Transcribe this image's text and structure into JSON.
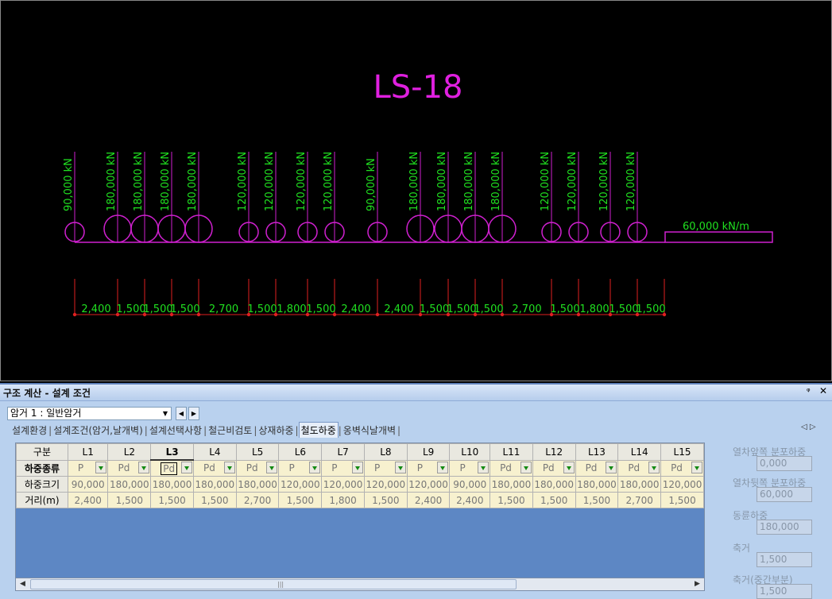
{
  "drawing": {
    "title": "LS-18",
    "loads": [
      {
        "label": "90,000 kN",
        "size": "small"
      },
      {
        "label": "180,000 kN",
        "size": "large"
      },
      {
        "label": "180,000 kN",
        "size": "large"
      },
      {
        "label": "180,000 kN",
        "size": "large"
      },
      {
        "label": "180,000 kN",
        "size": "large"
      },
      {
        "label": "120,000 kN",
        "size": "small"
      },
      {
        "label": "120,000 kN",
        "size": "small"
      },
      {
        "label": "120,000 kN",
        "size": "small"
      },
      {
        "label": "120,000 kN",
        "size": "small"
      },
      {
        "label": "90,000 kN",
        "size": "small"
      },
      {
        "label": "180,000 kN",
        "size": "large"
      },
      {
        "label": "180,000 kN",
        "size": "large"
      },
      {
        "label": "180,000 kN",
        "size": "large"
      },
      {
        "label": "180,000 kN",
        "size": "large"
      },
      {
        "label": "120,000 kN",
        "size": "small"
      },
      {
        "label": "120,000 kN",
        "size": "small"
      },
      {
        "label": "120,000 kN",
        "size": "small"
      },
      {
        "label": "120,000 kN",
        "size": "small"
      }
    ],
    "distributed_load": "60,000 kN/m",
    "spacings": [
      "2,400",
      "1,500",
      "1,500",
      "1,500",
      "2,700",
      "1,500",
      "1,800",
      "1,500",
      "2,400",
      "2,400",
      "1,500",
      "1,500",
      "1,500",
      "2,700",
      "1,500",
      "1,800",
      "1,500",
      "1,500"
    ],
    "colors": {
      "title": "#e020e0",
      "load_text": "#20e020",
      "shape": "#d020d0",
      "dim_line": "#e02020",
      "background": "#000000"
    }
  },
  "panel": {
    "title": "구조 계산 - 설계 조건",
    "pin_icon": "pin-icon",
    "close_icon": "close-icon",
    "combo_value": "암거 1 : 일반암거",
    "tabs": [
      "설계환경",
      "설계조건(암거,날개벽)",
      "설계선택사항",
      "철근비검토",
      "상재하중",
      "철도하중",
      "옹벽식날개벽"
    ],
    "active_tab": 5,
    "grid": {
      "corner": "구분",
      "columns": [
        "L1",
        "L2",
        "L3",
        "L4",
        "L5",
        "L6",
        "L7",
        "L8",
        "L9",
        "L10",
        "L11",
        "L12",
        "L13",
        "L14",
        "L15"
      ],
      "row_labels": [
        "하중종류",
        "하중크기",
        "거리(m)"
      ],
      "load_types": [
        "P",
        "Pd",
        "Pd",
        "Pd",
        "Pd",
        "P",
        "P",
        "P",
        "P",
        "P",
        "Pd",
        "Pd",
        "Pd",
        "Pd",
        "Pd"
      ],
      "load_sizes": [
        "90,000",
        "180,000",
        "180,000",
        "180,000",
        "180,000",
        "120,000",
        "120,000",
        "120,000",
        "120,000",
        "90,000",
        "180,000",
        "180,000",
        "180,000",
        "180,000",
        "120,000"
      ],
      "distances": [
        "2,400",
        "1,500",
        "1,500",
        "1,500",
        "2,700",
        "1,500",
        "1,800",
        "1,500",
        "2,400",
        "2,400",
        "1,500",
        "1,500",
        "1,500",
        "2,700",
        "1,500"
      ],
      "selected_column": 2
    },
    "side": [
      {
        "label": "열차앞쪽 분포하중",
        "value": "0,000"
      },
      {
        "label": "열차뒷쪽 분포하중",
        "value": "60,000"
      },
      {
        "label": "동륜하중",
        "value": "180,000"
      },
      {
        "label": "축거",
        "value": "1,500"
      },
      {
        "label": "축거(중간부분)",
        "value": "1,500"
      }
    ]
  }
}
